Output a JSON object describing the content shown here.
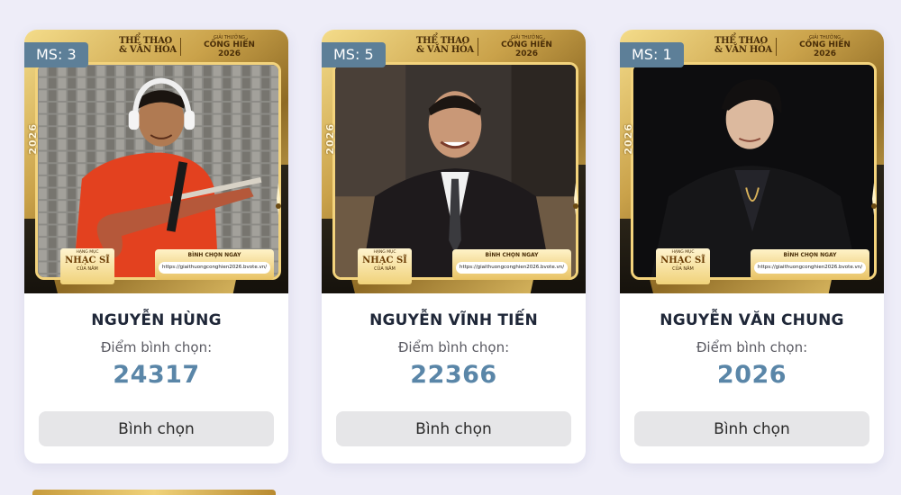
{
  "poster": {
    "brand_line1": "THỂ THAO",
    "brand_line2": "& VĂN HÓA",
    "award_small": "GIẢI THƯỞNG",
    "award_line1": "CỐNG HIẾN",
    "award_year": "2026",
    "year_vertical": "2026",
    "category_small": "HẠNG MỤC",
    "category_big": "NHẠC SĨ",
    "category_sub": "CỦA NĂM",
    "vote_now": "BÌNH CHỌN NGAY",
    "vote_url": "https://giaithuongconghien2026.bvote.vn/"
  },
  "score_label": "Điểm bình chọn:",
  "vote_button_label": "Bình chọn",
  "candidates": [
    {
      "badge": "MS: 3",
      "name": "NGUYỄN HÙNG",
      "score": "24317",
      "photo": "guitarist-with-headphones"
    },
    {
      "badge": "MS: 5",
      "name": "NGUYỄN VĨNH TIẾN",
      "score": "22366",
      "photo": "man-in-suit"
    },
    {
      "badge": "MS: 1",
      "name": "NGUYỄN VĂN CHUNG",
      "score": "2026",
      "photo": "man-in-black"
    }
  ],
  "colors": {
    "background": "#eeedf8",
    "badge": "#5d7f98",
    "score": "#5a86a8",
    "button": "#e6e6e8",
    "gold": "#caa24a"
  }
}
